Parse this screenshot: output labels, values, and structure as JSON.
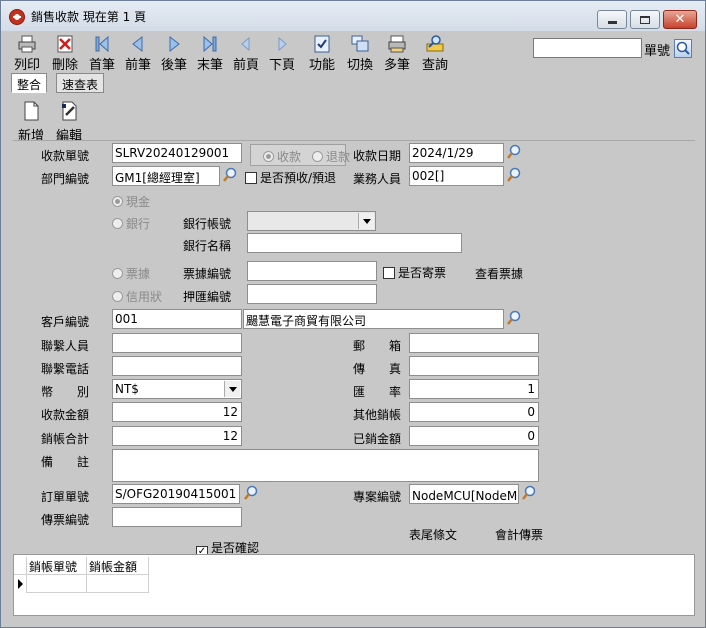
{
  "window": {
    "title": "銷售收款 現在第 1 頁"
  },
  "toolbar": [
    {
      "key": "print",
      "label": "列印",
      "icon": "printer-icon"
    },
    {
      "key": "delete",
      "label": "刪除",
      "icon": "delete-icon"
    },
    {
      "key": "first",
      "label": "首筆",
      "icon": "first-record-icon"
    },
    {
      "key": "prev",
      "label": "前筆",
      "icon": "previous-record-icon"
    },
    {
      "key": "next",
      "label": "後筆",
      "icon": "next-record-icon"
    },
    {
      "key": "last",
      "label": "末筆",
      "icon": "last-record-icon"
    },
    {
      "key": "prevpage",
      "label": "前頁",
      "icon": "previous-page-icon"
    },
    {
      "key": "nextpage",
      "label": "下頁",
      "icon": "next-page-icon"
    },
    {
      "key": "function",
      "label": "功能",
      "icon": "function-icon"
    },
    {
      "key": "switch",
      "label": "切換",
      "icon": "switch-icon"
    },
    {
      "key": "multi",
      "label": "多筆",
      "icon": "multi-record-icon"
    },
    {
      "key": "query",
      "label": "查詢",
      "icon": "query-icon"
    }
  ],
  "search": {
    "value": "",
    "label": "單號"
  },
  "tabs": [
    {
      "label": "整合"
    },
    {
      "label": "速查表"
    }
  ],
  "toolbar2": [
    {
      "label": "新增"
    },
    {
      "label": "編輯"
    }
  ],
  "form": {
    "receipt_no_label": "收款單號",
    "receipt_no": "SLRV20240129001",
    "type_receipt": "收款",
    "type_refund": "退款",
    "receipt_date_label": "收款日期",
    "receipt_date": "2024/1/29",
    "dept_label": "部門編號",
    "dept": "GM1[總經理室]",
    "prepay_label": "是否預收/預退",
    "sales_label": "業務人員",
    "sales": "002[]",
    "cash": "現金",
    "bank": "銀行",
    "bank_account_label": "銀行帳號",
    "bank_account": "",
    "bank_name_label": "銀行名稱",
    "bank_name": "",
    "bill": "票據",
    "bill_no_label": "票據編號",
    "bill_no": "",
    "bill_sent_label": "是否寄票",
    "view_bill_label": "查看票據",
    "lc": "信用狀",
    "remit_no_label": "押匯編號",
    "remit_no": "",
    "customer_label": "客戶編號",
    "customer_code": "001",
    "customer_name": "颺慧電子商貿有限公司",
    "contact_label": "聯繫人員",
    "contact": "",
    "email_label": "郵　　箱",
    "email": "",
    "phone_label": "聯繫電話",
    "phone": "",
    "fax_label": "傳　　真",
    "fax": "",
    "currency_label": "幣　　別",
    "currency": "NT$",
    "rate_label": "匯　　率",
    "rate": "1",
    "amount_label": "收款金額",
    "amount": "12",
    "other_writeoff_label": "其他銷帳",
    "other_writeoff": "0",
    "writeoff_total_label": "銷帳合計",
    "writeoff_total": "12",
    "written_off_label": "已銷金額",
    "written_off": "0",
    "memo_label": "備　　註",
    "memo": "",
    "order_no_label": "訂單單號",
    "order_no": "S/OFG20190415001",
    "project_label": "專案編號",
    "project": "NodeMCU[NodeMCU模",
    "voucher_label": "傳票編號",
    "voucher": "",
    "footer_text_label": "表尾條文",
    "accounting_voucher_label": "會計傳票",
    "confirmed_label": "是否確認"
  },
  "grid": {
    "columns": [
      "銷帳單號",
      "銷帳金額"
    ]
  }
}
